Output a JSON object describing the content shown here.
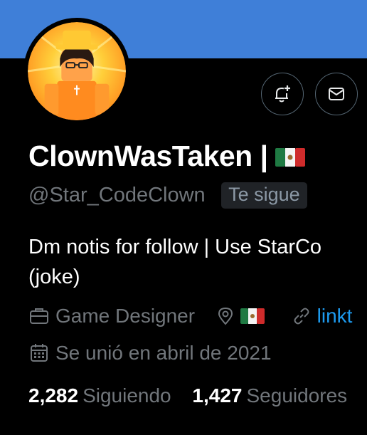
{
  "profile": {
    "display_name": "ClownWasTaken |",
    "handle": "@Star_CodeClown",
    "follows_you": "Te sigue",
    "bio_line1": "Dm notis for follow | Use StarCo",
    "bio_line2": "(joke)",
    "occupation": "Game Designer",
    "link": "linkt",
    "joined": "Se unió en abril de 2021",
    "following_count": "2,282",
    "following_label": "Siguiendo",
    "followers_count": "1,427",
    "followers_label": "Seguidores"
  },
  "icons": {
    "notifications": "bell-plus-icon",
    "message": "envelope-icon",
    "occupation": "briefcase-icon",
    "location": "location-pin-icon",
    "link": "link-icon",
    "joined": "calendar-icon",
    "flag": "mexico-flag"
  },
  "colors": {
    "banner": "#3f7fd8",
    "background": "#000000",
    "primary_text": "#ffffff",
    "secondary_text": "#71767b",
    "link": "#1d9bf0",
    "badge_bg": "#202327"
  }
}
